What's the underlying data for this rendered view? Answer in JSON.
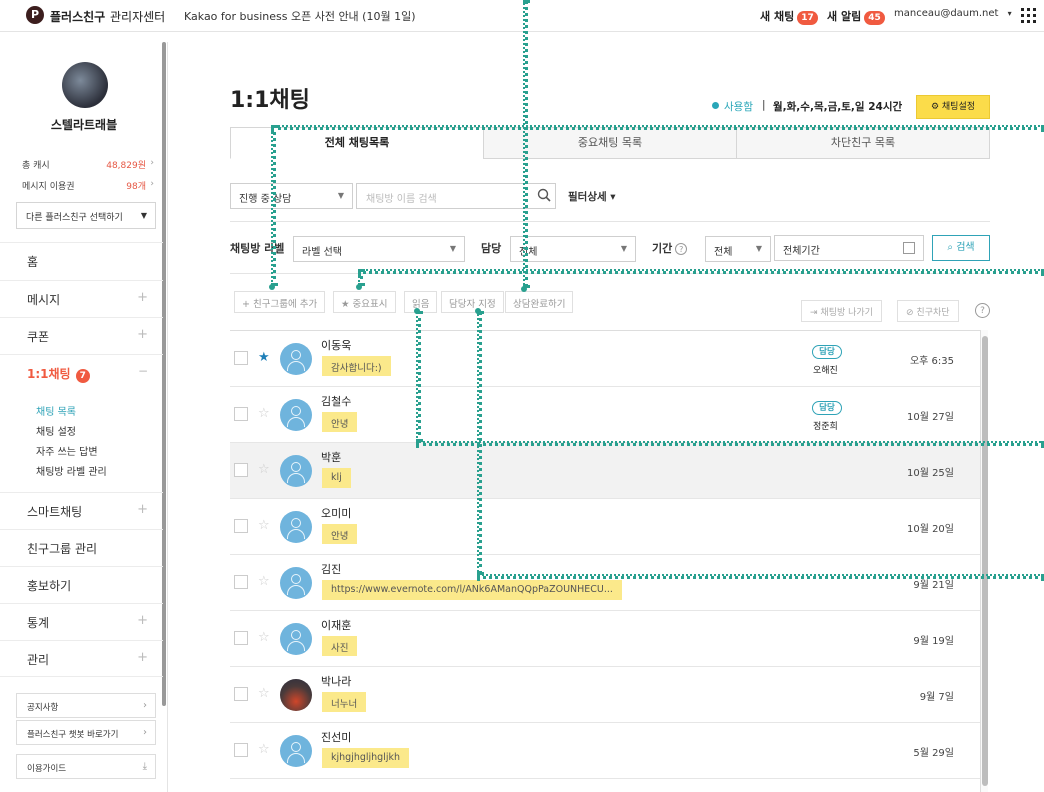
{
  "topbar": {
    "logo_mark": "P",
    "brand": "플러스친구",
    "brand_sub": "관리자센터",
    "notice": "Kakao for business 오픈 사전 안내 (10월 1일)",
    "new_chat_label": "새 채팅",
    "new_chat_count": "17",
    "new_alert_label": "새 알림",
    "new_alert_count": "45",
    "account": "manceau@daum.net",
    "account_caret": "▾"
  },
  "sidebar": {
    "profile_name": "스텔라트래블",
    "stats": [
      {
        "label": "총 캐시",
        "value": "48,829원"
      },
      {
        "label": "메시지 이용권",
        "value": "98개"
      }
    ],
    "select_friend": "다른 플러스친구 선택하기",
    "nav": [
      {
        "label": "홈",
        "expand": ""
      },
      {
        "label": "메시지",
        "expand": "+"
      },
      {
        "label": "쿠폰",
        "expand": "+"
      },
      {
        "label": "1:1채팅",
        "badge": "7",
        "expand": "−"
      },
      {
        "label": "스마트채팅",
        "expand": "+"
      },
      {
        "label": "친구그룹 관리",
        "expand": ""
      },
      {
        "label": "홍보하기",
        "expand": ""
      },
      {
        "label": "통계",
        "expand": "+"
      },
      {
        "label": "관리",
        "expand": "+"
      }
    ],
    "sub_nav": [
      "채팅 목록",
      "채팅 설정",
      "자주 쓰는 답변",
      "채팅방 라벨 관리"
    ],
    "bottom_links": [
      "공지사항",
      "플러스친구 챗봇 바로가기",
      "이용가이드"
    ]
  },
  "main": {
    "title": "1:1채팅",
    "status": "사용함",
    "status_sep": "|",
    "schedule": "월,화,수,목,금,토,일 24시간",
    "settings_button": "채팅설정",
    "tabs": [
      "전체 채팅목록",
      "중요채팅 목록",
      "차단친구 목록"
    ],
    "filter": {
      "status_select": "진행 중 상담",
      "search_placeholder": "채팅방 이름 검색",
      "filter_detail": "필터상세 ▾",
      "label_title": "채팅방 라벨",
      "label_select": "라벨 선택",
      "assignee_title": "담당",
      "assignee_select": "전체",
      "period_title": "기간",
      "period_select": "전체",
      "period_input": "전체기간",
      "search_button": "검색"
    },
    "actions": [
      "+ 친구그룹에 추가",
      "★ 중요표시",
      "읽음",
      "담당자 지정",
      "상담완료하기"
    ],
    "right_actions": [
      "채팅방 나가기",
      "친구차단"
    ],
    "help": "?",
    "rows": [
      {
        "name": "이동욱",
        "message": "감사합니다:)",
        "tag": "담당",
        "assignee": "오해진",
        "time": "오후 6:35",
        "starred": true,
        "avatar": "default"
      },
      {
        "name": "김철수",
        "message": "안녕",
        "tag": "담당",
        "assignee": "정준희",
        "time": "10월 27일",
        "starred": false,
        "avatar": "default"
      },
      {
        "name": "박훈",
        "message": "klj",
        "tag": "",
        "assignee": "",
        "time": "10월 25일",
        "starred": false,
        "avatar": "default"
      },
      {
        "name": "오미미",
        "message": "안녕",
        "tag": "",
        "assignee": "",
        "time": "10월 20일",
        "starred": false,
        "avatar": "default"
      },
      {
        "name": "김진",
        "message": "https://www.evernote.com/l/ANk6AManQQpPaZOUNHECU...",
        "tag": "",
        "assignee": "",
        "time": "9월 21일",
        "starred": false,
        "avatar": "default"
      },
      {
        "name": "이재훈",
        "message": "사진",
        "tag": "",
        "assignee": "",
        "time": "9월 19일",
        "starred": false,
        "avatar": "default"
      },
      {
        "name": "박나라",
        "message": "너누너",
        "tag": "",
        "assignee": "",
        "time": "9월 7일",
        "starred": false,
        "avatar": "photo"
      },
      {
        "name": "진선미",
        "message": "kjhgjhgljhgljkh",
        "tag": "",
        "assignee": "",
        "time": "5월 29일",
        "starred": false,
        "avatar": "default"
      }
    ]
  },
  "colors": {
    "accent": "#2fa3b7",
    "badge_red": "#f05a40",
    "settings_yellow": "#fbdc4a",
    "message_bubble": "#fbe98b",
    "guide": "#29a08f"
  }
}
